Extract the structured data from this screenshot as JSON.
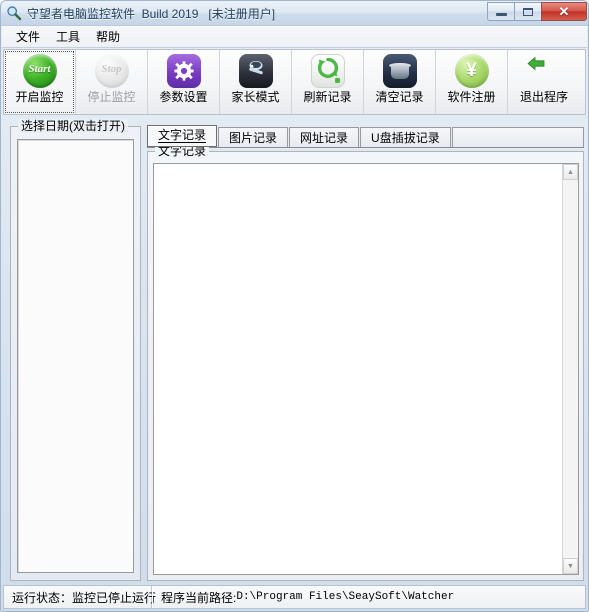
{
  "window": {
    "title": "守望者电脑监控软件  Build 2019   [未注册用户]",
    "app_icon": "magnifier-icon",
    "controls": {
      "minimize": "–",
      "maximize": "□",
      "close": "✕"
    }
  },
  "menu": {
    "items": [
      {
        "label": "文件"
      },
      {
        "label": "工具"
      },
      {
        "label": "帮助"
      }
    ]
  },
  "toolbar": {
    "buttons": [
      {
        "label": "开启监控",
        "icon": "start-monitor-icon",
        "icon_text": "Start",
        "state": "focused"
      },
      {
        "label": "停止监控",
        "icon": "stop-monitor-icon",
        "icon_text": "Stop",
        "state": "disabled"
      },
      {
        "label": "参数设置",
        "icon": "gear-settings-icon",
        "icon_text": "✷",
        "state": "normal"
      },
      {
        "label": "家长模式",
        "icon": "parent-mode-icon",
        "icon_text": "☂",
        "state": "normal"
      },
      {
        "label": "刷新记录",
        "icon": "refresh-records-icon",
        "icon_text": "⟳",
        "state": "normal"
      },
      {
        "label": "清空记录",
        "icon": "clear-records-trash-icon",
        "icon_text": "",
        "state": "normal"
      },
      {
        "label": "软件注册",
        "icon": "register-yen-icon",
        "icon_text": "¥",
        "state": "normal"
      },
      {
        "label": "退出程序",
        "icon": "exit-door-icon",
        "icon_text": "⬅",
        "state": "normal"
      }
    ]
  },
  "left_panel": {
    "group_title": "选择日期(双击打开)",
    "list_items": []
  },
  "tabs": {
    "items": [
      {
        "label": "文字记录",
        "active": true
      },
      {
        "label": "图片记录",
        "active": false
      },
      {
        "label": "网址记录",
        "active": false
      },
      {
        "label": "U盘插拔记录",
        "active": false
      }
    ]
  },
  "records_panel": {
    "group_title": "文字记录",
    "content": "",
    "scrollbar": {
      "up_arrow": "▲",
      "down_arrow": "▼"
    }
  },
  "statusbar": {
    "run_state": "运行状态：监控已停止运行",
    "path_label": "程序当前路径:",
    "path_value": "D:\\Program Files\\SeaySoft\\Watcher"
  },
  "colors": {
    "titlebar_start": "#eaf1f8",
    "titlebar_end": "#c5d5e8",
    "close_button": "#bf3427",
    "window_border": "#9fb6cd",
    "start_icon_green": "#3fb52a",
    "gear_purple": "#7b3fc4",
    "refresh_green": "#4cb944",
    "yen_green": "#a8d86a",
    "exit_door_orange": "#d98f37"
  }
}
